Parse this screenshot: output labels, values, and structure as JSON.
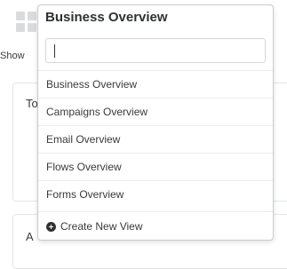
{
  "background": {
    "show_label": "Show",
    "card1_title": "To",
    "card2_title": "A"
  },
  "dropdown": {
    "title": "Business Overview",
    "search": {
      "value": "",
      "placeholder": ""
    },
    "items": [
      {
        "label": "Business Overview"
      },
      {
        "label": "Campaigns Overview"
      },
      {
        "label": "Email Overview"
      },
      {
        "label": "Flows Overview"
      },
      {
        "label": "Forms Overview"
      }
    ],
    "footer": {
      "label": "Create New View",
      "icon": "plus-circle-icon"
    }
  }
}
